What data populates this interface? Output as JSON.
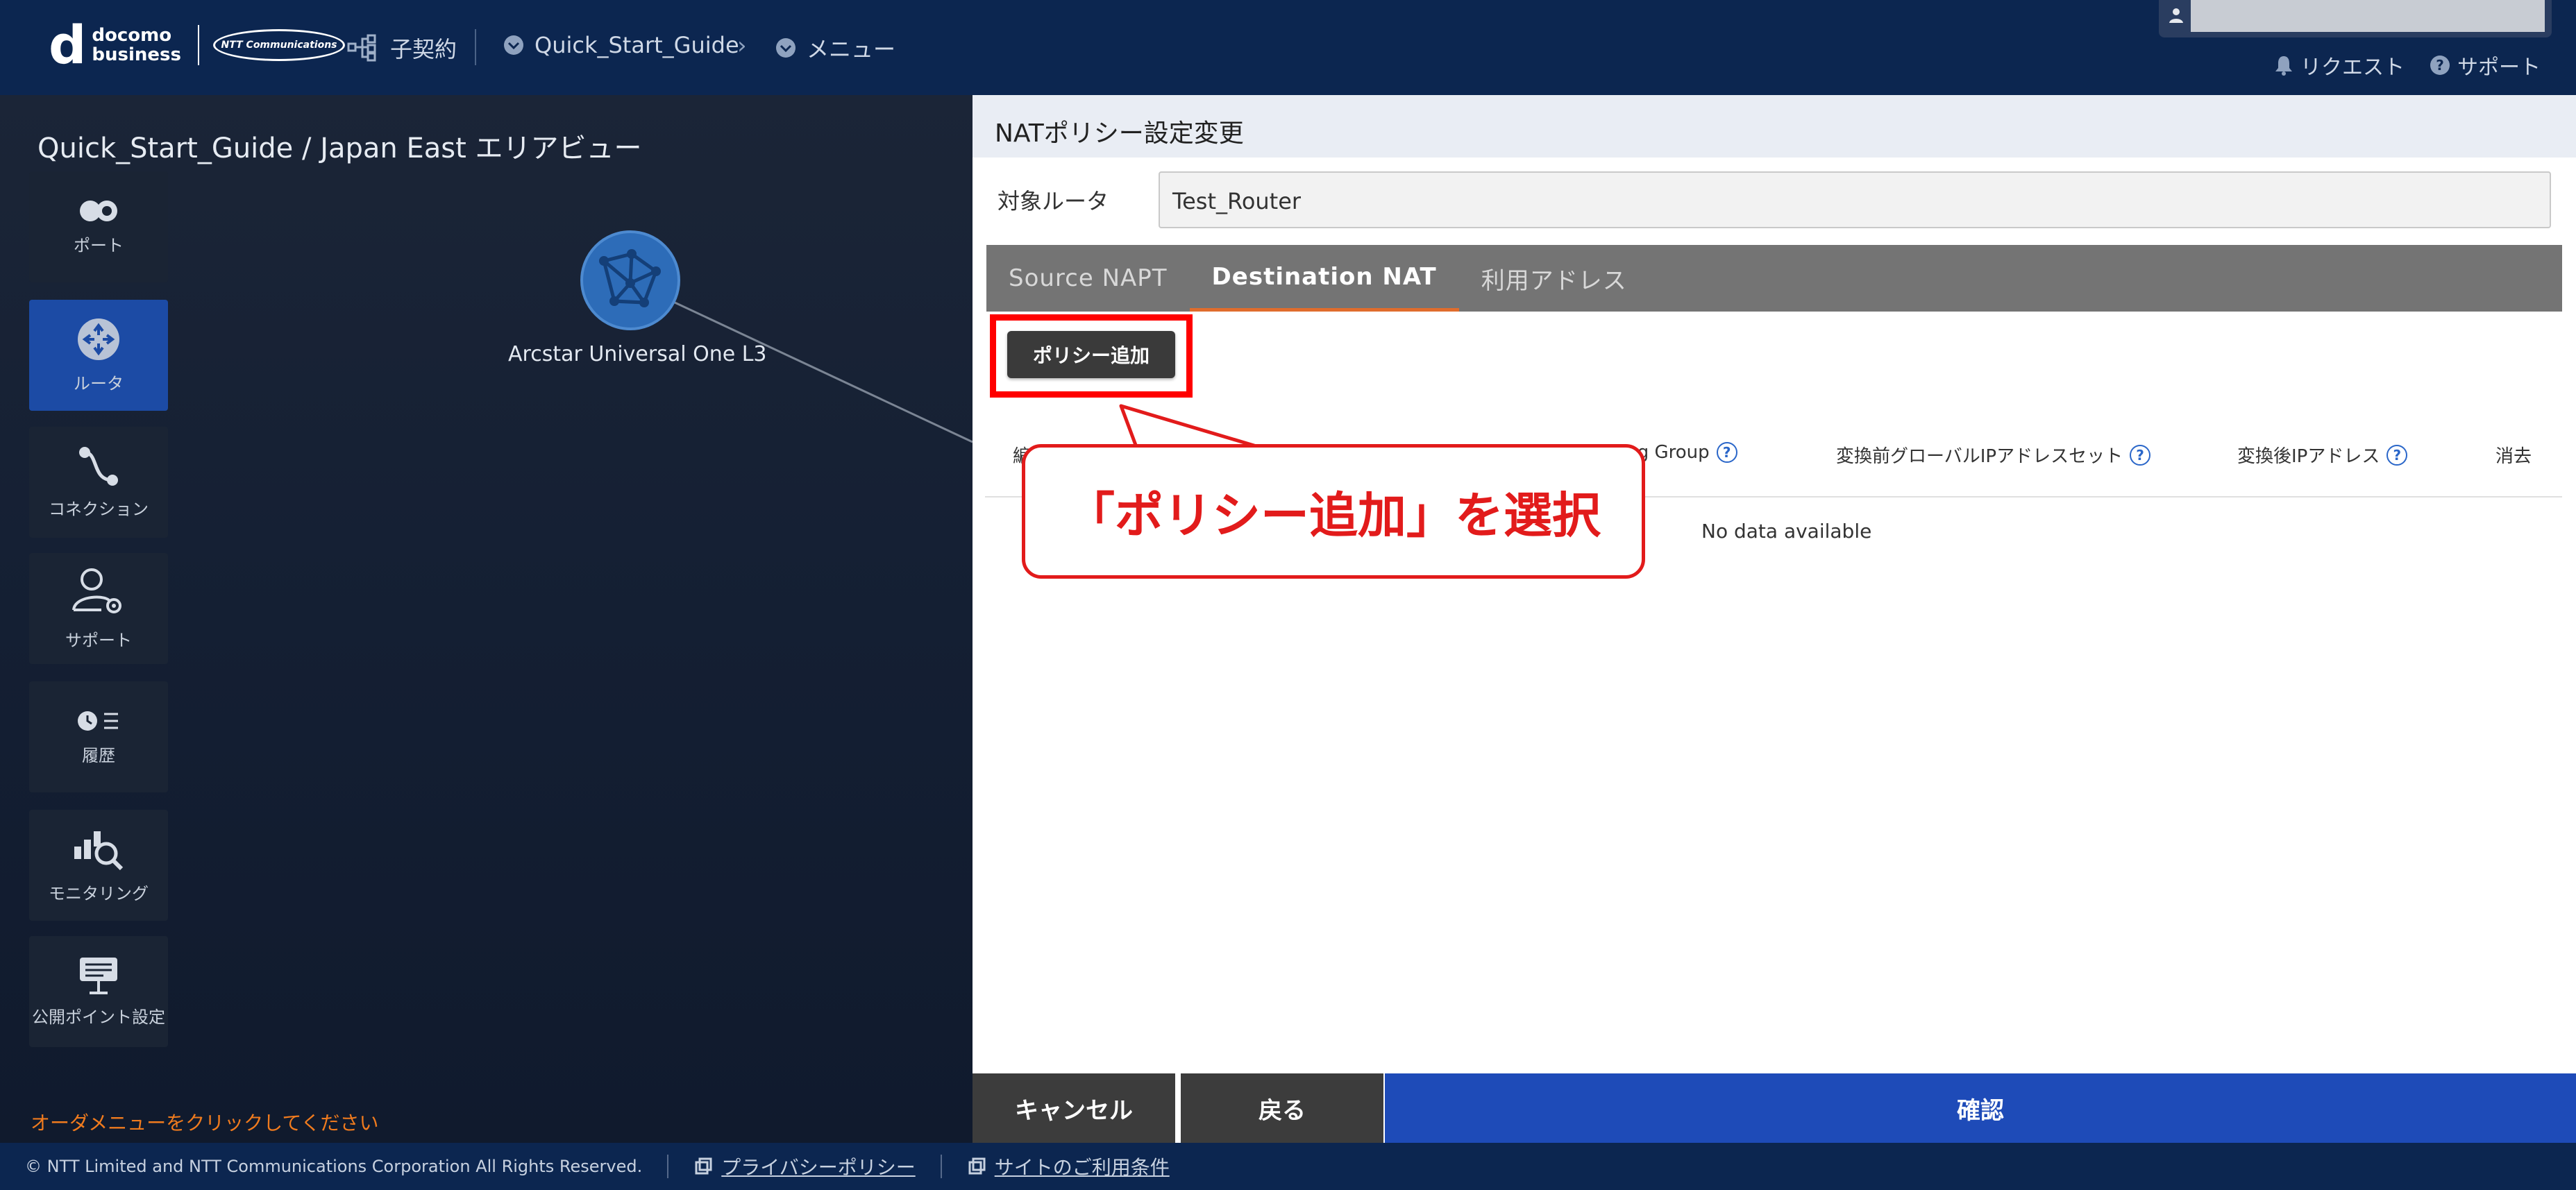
{
  "header": {
    "brand_main": "docomo",
    "brand_sub": "business",
    "ntt_logo": "NTT Communications",
    "sub_contract": "子契約",
    "breadcrumb": [
      "Quick_Start_Guide",
      "メニュー"
    ],
    "request": "リクエスト",
    "support": "サポート"
  },
  "map": {
    "area_title": "Quick_Start_Guide / Japan East エリアビュー",
    "router_node_label": "Arcstar Universal One L3",
    "order_hint": "オーダメニューをクリックしてください"
  },
  "sidebar": {
    "items": [
      {
        "label": "ポート",
        "icon": "port-icon"
      },
      {
        "label": "ルータ",
        "icon": "router-icon"
      },
      {
        "label": "コネクション",
        "icon": "connection-icon"
      },
      {
        "label": "サポート",
        "icon": "support-icon"
      },
      {
        "label": "履歴",
        "icon": "history-icon"
      },
      {
        "label": "モニタリング",
        "icon": "monitoring-icon"
      },
      {
        "label": "公開ポイント設定",
        "icon": "public-point-icon"
      }
    ],
    "active_index": 1
  },
  "panel": {
    "title": "NATポリシー設定変更",
    "target_label": "対象ルータ",
    "target_value": "Test_Router",
    "tabs": [
      "Source NAPT",
      "Destination NAT",
      "利用アドレス"
    ],
    "active_tab": 1,
    "add_policy": "ポリシー追加",
    "columns": [
      "編",
      "ing Group",
      "変換前グローバルIPアドレスセット",
      "変換後IPアドレス",
      "消去"
    ],
    "help_glyph": "?",
    "no_data": "No data available",
    "cancel": "キャンセル",
    "back": "戻る",
    "confirm": "確認"
  },
  "callout": {
    "text": "「ポリシー追加」を選択"
  },
  "footer": {
    "copyright": "© NTT Limited and NTT Communications Corporation All Rights Reserved.",
    "privacy": "プライバシーポリシー",
    "terms": "サイトのご利用条件"
  },
  "colors": {
    "header_bg": "#0c2650",
    "active_sidebar": "#1c4ba5",
    "confirm_bg": "#1e4bb8",
    "highlight_red": "#ff0000",
    "order_hint": "#f07b1e"
  }
}
